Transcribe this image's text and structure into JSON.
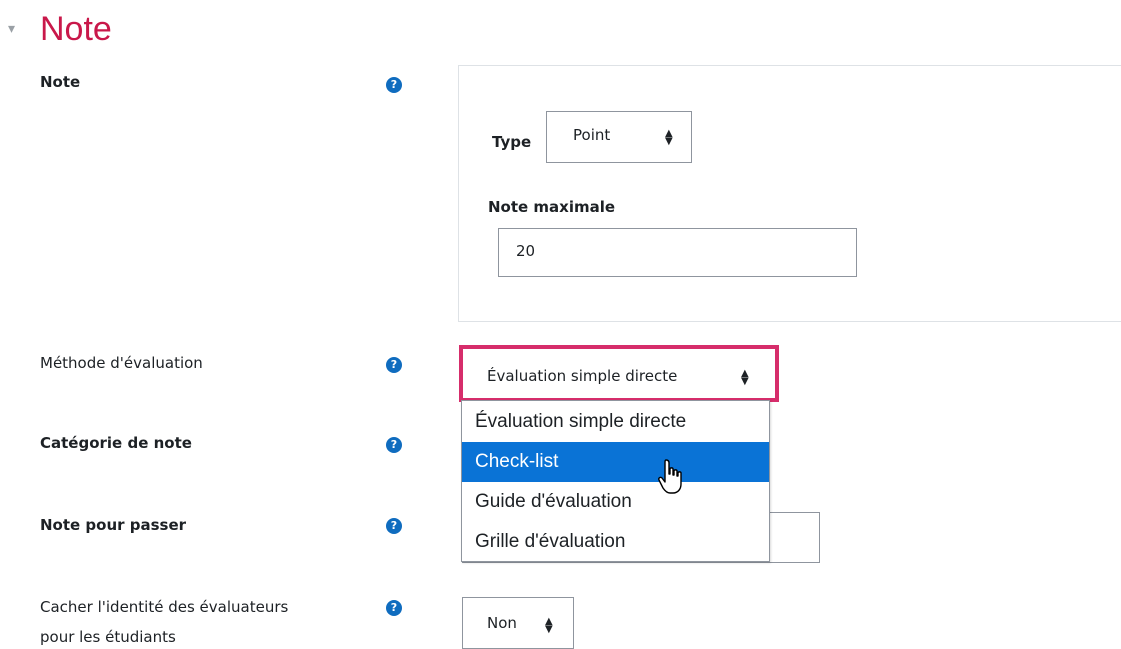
{
  "section": {
    "title": "Note",
    "toggle_icon": "collapse-triangle-icon"
  },
  "grade": {
    "label": "Note",
    "type_label": "Type",
    "type_value": "Point",
    "max_label": "Note maximale",
    "max_value": "20"
  },
  "grading_method": {
    "label": "Méthode d'évaluation",
    "selected": "Évaluation simple directe",
    "options": [
      "Évaluation simple directe",
      "Check-list",
      "Guide d'évaluation",
      "Grille d'évaluation"
    ],
    "highlighted_option": "Check-list"
  },
  "grade_category": {
    "label": "Catégorie de note"
  },
  "grade_to_pass": {
    "label": "Note pour passer"
  },
  "blind_marking": {
    "label_line1": "Cacher l'identité des évaluateurs",
    "label_line2": "pour les étudiants",
    "value": "Non"
  },
  "help_icon": "?",
  "colors": {
    "accent": "#c9184a",
    "highlight_frame": "#d62d6b",
    "help_icon": "#0f6cbf",
    "selected_option": "#0a73d6"
  }
}
